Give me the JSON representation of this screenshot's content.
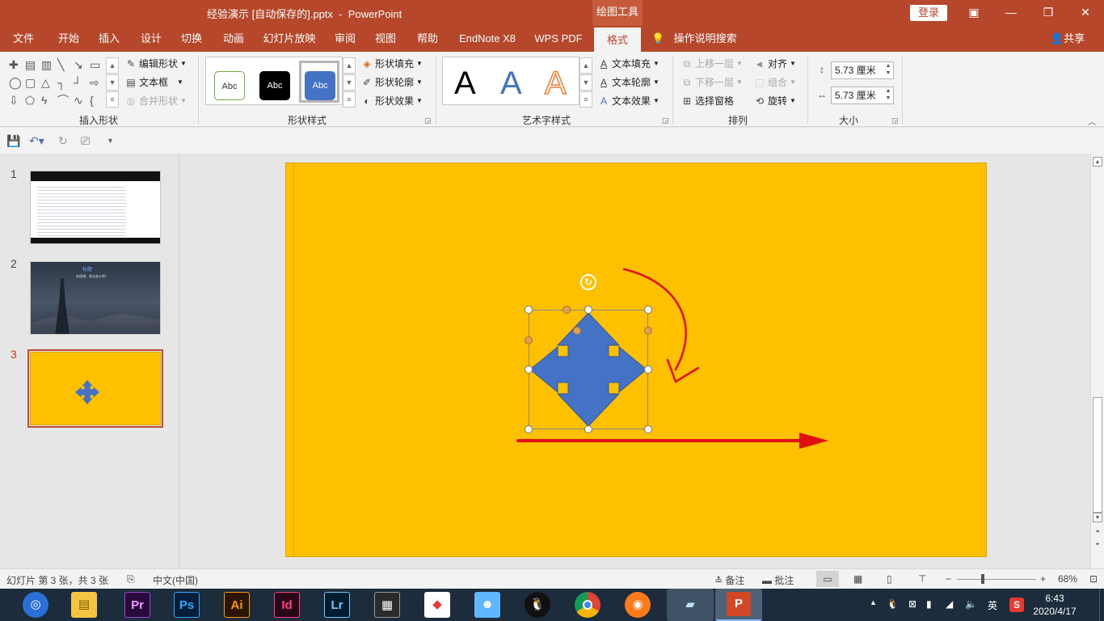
{
  "window": {
    "title": "经验演示 [自动保存的].pptx  -  PowerPoint",
    "context_tab_group": "绘图工具",
    "login_label": "登录"
  },
  "ribbon_tabs": [
    "文件",
    "开始",
    "插入",
    "设计",
    "切换",
    "动画",
    "幻灯片放映",
    "审阅",
    "视图",
    "帮助",
    "EndNote X8",
    "WPS PDF",
    "格式"
  ],
  "active_tab": "格式",
  "tell_me": "操作说明搜索",
  "share_label": "共享",
  "groups": {
    "insert_shapes": {
      "label": "插入形状",
      "edit_shape": "编辑形状",
      "text_box": "文本框",
      "merge_shapes": "合并形状"
    },
    "shape_styles": {
      "label": "形状样式",
      "swatches": [
        "Abc",
        "Abc",
        "Abc"
      ],
      "fill": "形状填充",
      "outline": "形状轮廓",
      "effects": "形状效果"
    },
    "wordart_styles": {
      "label": "艺术字样式",
      "samples": [
        "A",
        "A",
        "A"
      ],
      "text_fill": "文本填充",
      "text_outline": "文本轮廓",
      "text_effects": "文本效果"
    },
    "arrange": {
      "label": "排列",
      "bring_forward": "上移一层",
      "send_backward": "下移一层",
      "selection_pane": "选择窗格",
      "align": "对齐",
      "group": "组合",
      "rotate": "旋转"
    },
    "size": {
      "label": "大小",
      "height": "5.73 厘米",
      "width": "5.73 厘米"
    }
  },
  "slides": [
    {
      "number": "1"
    },
    {
      "number": "2",
      "caption": "标题",
      "subtitle": "有理想，就去奋斗吧！"
    },
    {
      "number": "3"
    }
  ],
  "current_slide": 3,
  "status": {
    "slide_info": "幻灯片 第 3 张，共 3 张",
    "language": "中文(中国)",
    "notes": "备注",
    "comments": "批注",
    "zoom": "68%"
  },
  "colors": {
    "accent": "#b7472a",
    "slide_bg": "#ffc000",
    "shape_fill": "#4472c4",
    "annotation": "#e01010"
  },
  "taskbar": {
    "apps": [
      "Pr",
      "Ps",
      "Ai",
      "Id",
      "Lr"
    ],
    "ime": "英",
    "time": "6:43",
    "date": "2020/4/17"
  }
}
